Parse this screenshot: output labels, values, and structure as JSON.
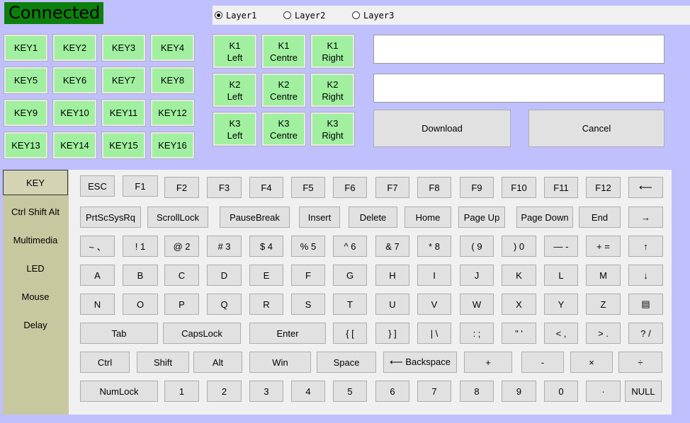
{
  "status": "Connected",
  "layers": [
    {
      "label": "Layer1",
      "selected": true
    },
    {
      "label": "Layer2",
      "selected": false
    },
    {
      "label": "Layer3",
      "selected": false
    }
  ],
  "keys": [
    "KEY1",
    "KEY2",
    "KEY3",
    "KEY4",
    "KEY5",
    "KEY6",
    "KEY7",
    "KEY8",
    "KEY9",
    "KEY10",
    "KEY11",
    "KEY12",
    "KEY13",
    "KEY14",
    "KEY15",
    "KEY16"
  ],
  "knobs": [
    "K1\nLeft",
    "K1\nCentre",
    "K1\nRight",
    "K2\nLeft",
    "K2\nCentre",
    "K2\nRight",
    "K3\nLeft",
    "K3\nCentre",
    "K3\nRight"
  ],
  "input1": "",
  "input2": "",
  "download_label": "Download",
  "cancel_label": "Cancel",
  "sidebar": [
    "KEY",
    "Ctrl Shift Alt",
    "Multimedia",
    "LED",
    "Mouse",
    "Delay"
  ],
  "sidebar_active": 0,
  "keyboard_rows": [
    [
      "ESC",
      "F1",
      "F2",
      "F3",
      "F4",
      "F5",
      "F6",
      "F7",
      "F8",
      "F9",
      "F10",
      "F11",
      "F12",
      "⟵"
    ],
    [
      "PrtScSysRq",
      "ScrollLock",
      "PauseBreak",
      "Insert",
      "Delete",
      "Home",
      "Page Up",
      "Page Down",
      "End",
      "→"
    ],
    [
      "~ 、",
      "! 1",
      "@ 2",
      "# 3",
      "$ 4",
      "% 5",
      "^ 6",
      "& 7",
      "* 8",
      "( 9",
      ") 0",
      "— -",
      "+ =",
      "↑"
    ],
    [
      "A",
      "B",
      "C",
      "D",
      "E",
      "F",
      "G",
      "H",
      "I",
      "J",
      "K",
      "L",
      "M",
      "↓"
    ],
    [
      "N",
      "O",
      "P",
      "Q",
      "R",
      "S",
      "T",
      "U",
      "V",
      "W",
      "X",
      "Y",
      "Z",
      "▤"
    ],
    [
      "Tab",
      "CapsLock",
      "Enter",
      "{ [",
      "} ]",
      "| \\",
      ": ;",
      "\" '",
      "< ,",
      "> .",
      "? /"
    ],
    [
      "Ctrl",
      "Shift",
      "Alt",
      "Win",
      "Space",
      "⟵ Backspace",
      "+",
      "-",
      "×",
      "÷"
    ],
    [
      "NumLock",
      "1",
      "2",
      "3",
      "4",
      "5",
      "6",
      "7",
      "8",
      "9",
      "0",
      "·",
      "NULL"
    ]
  ]
}
